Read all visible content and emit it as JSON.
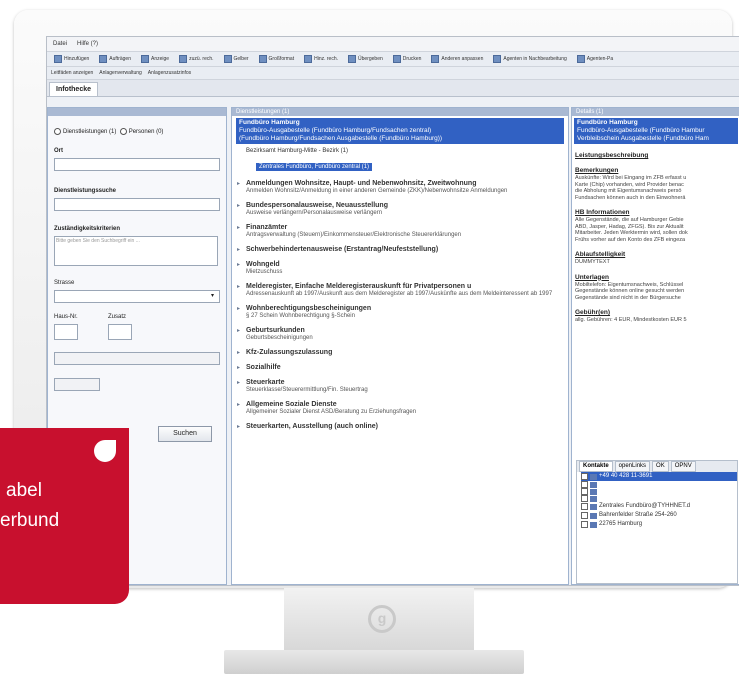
{
  "menu": [
    "Datei",
    "Hilfe (?)"
  ],
  "toolbar": {
    "buttons": [
      "Hinzufügen",
      "Aufträgen",
      "Anzeige",
      "zuzü. rech.",
      "Gelber",
      "Großformat",
      "Hinz. rech.",
      "Übergeben",
      "Drucken",
      "Anderen anpassen",
      "Agenten in Nachbearbeitung",
      "Agenten-Pa"
    ],
    "row2": [
      "Leitfäden anzeigen",
      "Anlagenverwaltung",
      "Anlagenzusatzinfos"
    ]
  },
  "tab": {
    "label": "Infothecke"
  },
  "left": {
    "radio1": "Dienstleistungen (1)",
    "radio2": "Personen (0)",
    "ort_label": "Ort",
    "dienst_label": "Dienstleistungssuche",
    "zust_label": "Zuständigkeitskriterien",
    "zust_placeholder": "Bitte geben Sie den Suchbegriff ein ...",
    "strasse_label": "Strasse",
    "hausnr_label": "Haus-Nr.",
    "zusatz_label": "Zusatz",
    "search_button": "Suchen"
  },
  "mid": {
    "header": "Dienstleistungen (1)",
    "selected_title": "Fundbüro Hamburg",
    "selected_lines": [
      "Fundbüro-Ausgabestelle (Fundbüro Hamburg/Fundsachen zentral)",
      "(Fundbüro Hamburg/Fundsachen Ausgabestelle (Fundbüro Hamburg))"
    ],
    "sub_row": "Bezirksamt Hamburg-Mitte - Bezirk   (1)",
    "sub_selected": "Zentrales Fundbüro, Fundbüro zentral (1)",
    "items": [
      {
        "title": "Anmeldungen Wohnsitze, Haupt- und Nebenwohnsitz, Zweitwohnung",
        "desc": "Anmelden Wohnsitz/Anmeldung in einer anderen Gemeinde (ZKK)/Nebenwohnsitze Anmeldungen"
      },
      {
        "title": "Bundespersonalausweise, Neuausstellung",
        "desc": "Ausweise verlängern/Personalausweise verlängern"
      },
      {
        "title": "Finanzämter",
        "desc": "Antragsverwaltung (Steuern)/Einkommensteuer/Elektronische Steuererklärungen"
      },
      {
        "title": "Schwerbehindertenausweise (Erstantrag/Neufeststellung)",
        "desc": ""
      },
      {
        "title": "Wohngeld",
        "desc": "Mietzuschuss"
      },
      {
        "title": "Melderegister, Einfache Melderegisterauskunft für Privatpersonen u",
        "desc": "Adressenauskunft ab 1997/Auskunft aus dem Melderegister ab 1997/Auskünfte aus dem Meldeinteressent ab 1997"
      },
      {
        "title": "Wohnberechtigungsbescheinigungen",
        "desc": "§ 27 Schein Wohnberechtigung §-Schein"
      },
      {
        "title": "Geburtsurkunden",
        "desc": "Geburtsbescheinigungen"
      },
      {
        "title": "Kfz-Zulassungszulassung",
        "desc": ""
      },
      {
        "title": "Sozialhilfe",
        "desc": ""
      },
      {
        "title": "Steuerkarte",
        "desc": "Steuerklasse/Steuerermittlung/Fin. Steuertrag"
      },
      {
        "title": "Allgemeine Soziale Dienste",
        "desc": "Allgemeiner Sozialer Dienst ASD/Beratung zu Erziehungsfragen"
      },
      {
        "title": "Steuerkarten, Ausstellung (auch online)",
        "desc": ""
      }
    ]
  },
  "right": {
    "header": "Details (1)",
    "selected_title": "Fundbüro Hamburg",
    "selected_lines": [
      "Fundbüro-Ausgabestelle (Fundbüro Hambur",
      "Verbleibschein Ausgabestelle (Fundbüro Ham"
    ],
    "sections": [
      {
        "h": "Leistungsbeschreibung",
        "lines": []
      },
      {
        "h": "Bemerkungen",
        "lines": [
          "Auskünfte: Wird bei Eingang im ZFB erfasst u",
          "Karte (Chip) vorhanden, wird Provider benac",
          "die Abholung mit Eigentumsnachweis persö",
          "Fundsachen können auch in den Einwohnerä"
        ]
      },
      {
        "h": "HB Informationen",
        "lines": [
          "Alle Gegenstände, die auf Hamburger Gebie",
          "ABD, Jasper, Hadag, ZFGS). Bis zur Aktualit",
          "Mitarbeiter. Jeden Werktermin wird, sollen dok",
          "Frühs vorher auf den Konto des ZFB eingeza"
        ]
      },
      {
        "h": "Ablaufstelligkeit",
        "lines": [
          "DUMMYTEXT"
        ]
      },
      {
        "h": "Unterlagen",
        "lines": [
          "Mobiltelefon: Eigentumsnachweis, Schlüssel",
          "Gegenstände können online gesucht werden",
          "Gegenstände sind nicht in der Bürgersuche"
        ]
      },
      {
        "h": "Gebühr(en)",
        "lines": [
          "allg. Gebühren: 4 EUR, Mindestkosten EUR 5"
        ]
      }
    ],
    "ktabs": [
      "Kontakte",
      "openLinks",
      "OK",
      "OPNV"
    ],
    "contacts": [
      "+49 40 428 11-3691",
      "",
      "",
      "",
      "Zentrales Fundbüro@TYHHNET.d",
      "Bahrenfelder Straße 254-260",
      "22765 Hamburg"
    ]
  },
  "banner": {
    "line1": "abel",
    "line2": "erbund"
  },
  "colors": {
    "accent": "#3161c3",
    "banner": "#c8102e"
  }
}
